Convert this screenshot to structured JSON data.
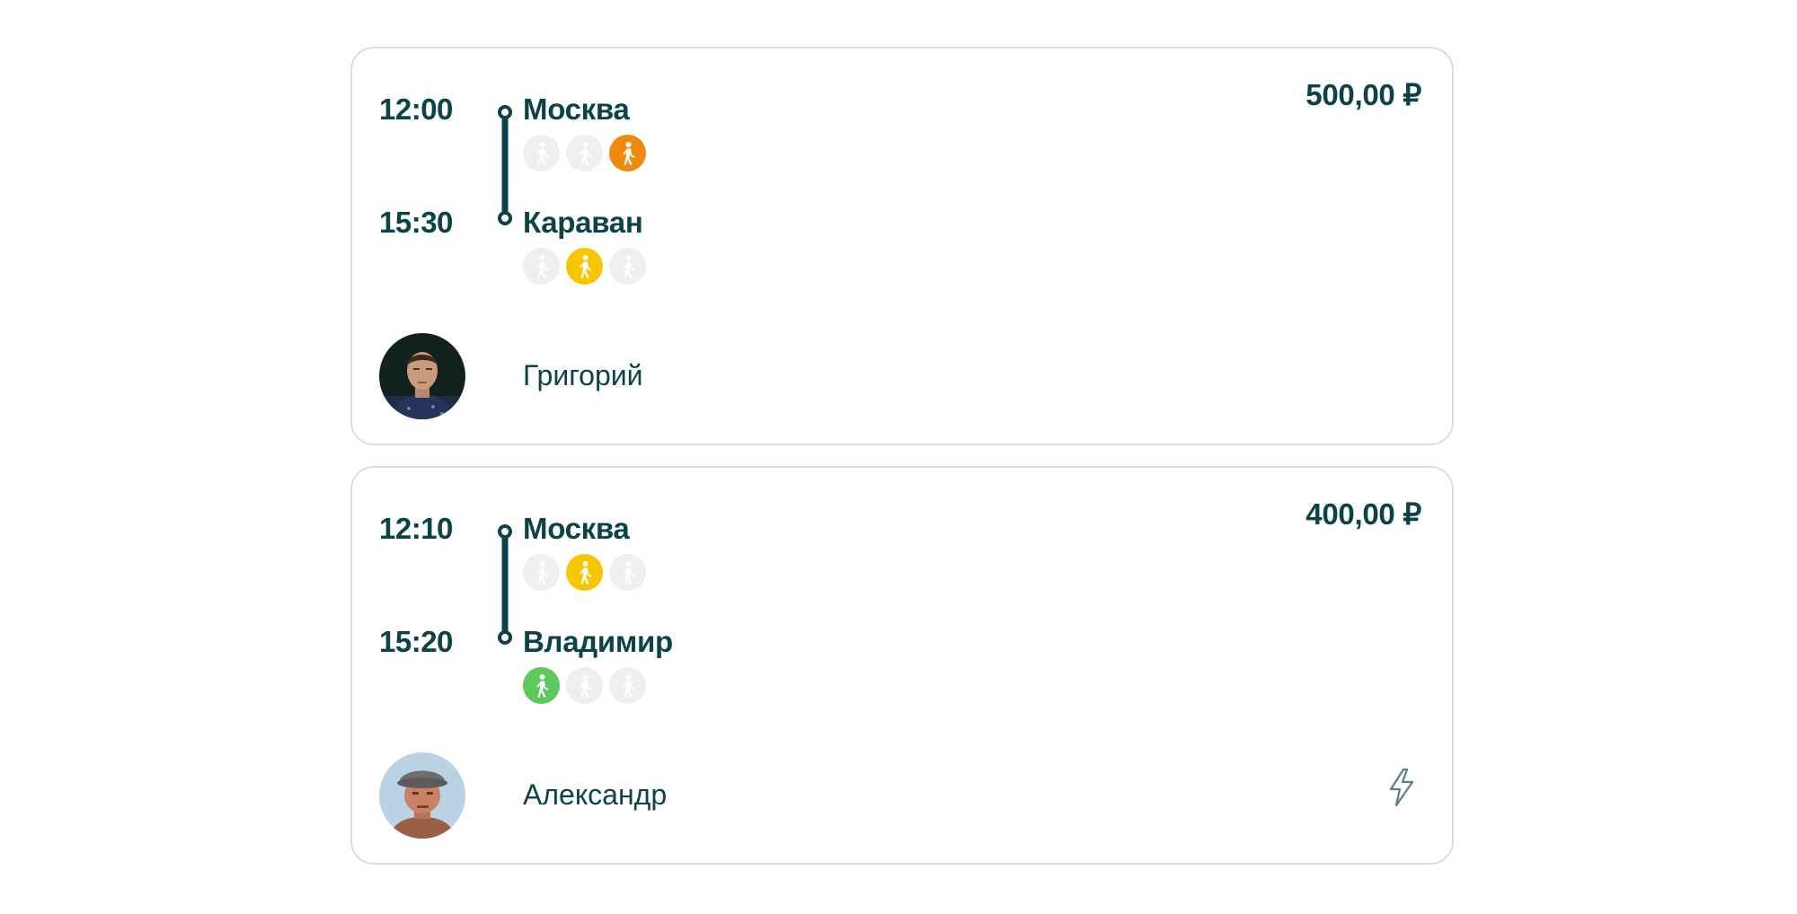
{
  "trips": [
    {
      "departure_time": "12:00",
      "arrival_time": "15:30",
      "from_city": "Москва",
      "to_city": "Караван",
      "price": "500,00 ₽",
      "driver_name": "Григорий",
      "from_seats": [
        "empty",
        "empty",
        "orange"
      ],
      "to_seats": [
        "empty",
        "yellow",
        "empty"
      ],
      "instant_booking": false
    },
    {
      "departure_time": "12:10",
      "arrival_time": "15:20",
      "from_city": "Москва",
      "to_city": "Владимир",
      "price": "400,00 ₽",
      "driver_name": "Александр",
      "from_seats": [
        "empty",
        "yellow",
        "empty"
      ],
      "to_seats": [
        "green",
        "empty",
        "empty"
      ],
      "instant_booking": true
    }
  ],
  "colors": {
    "text": "#0b4349",
    "card_border": "#dcdcdc",
    "seat_empty": "#efefef",
    "seat_orange": "#f08a0e",
    "seat_yellow": "#f7c600",
    "seat_green": "#5cca5a"
  },
  "icons": {
    "seat": "walking-person-icon",
    "instant_booking": "lightning-icon"
  }
}
